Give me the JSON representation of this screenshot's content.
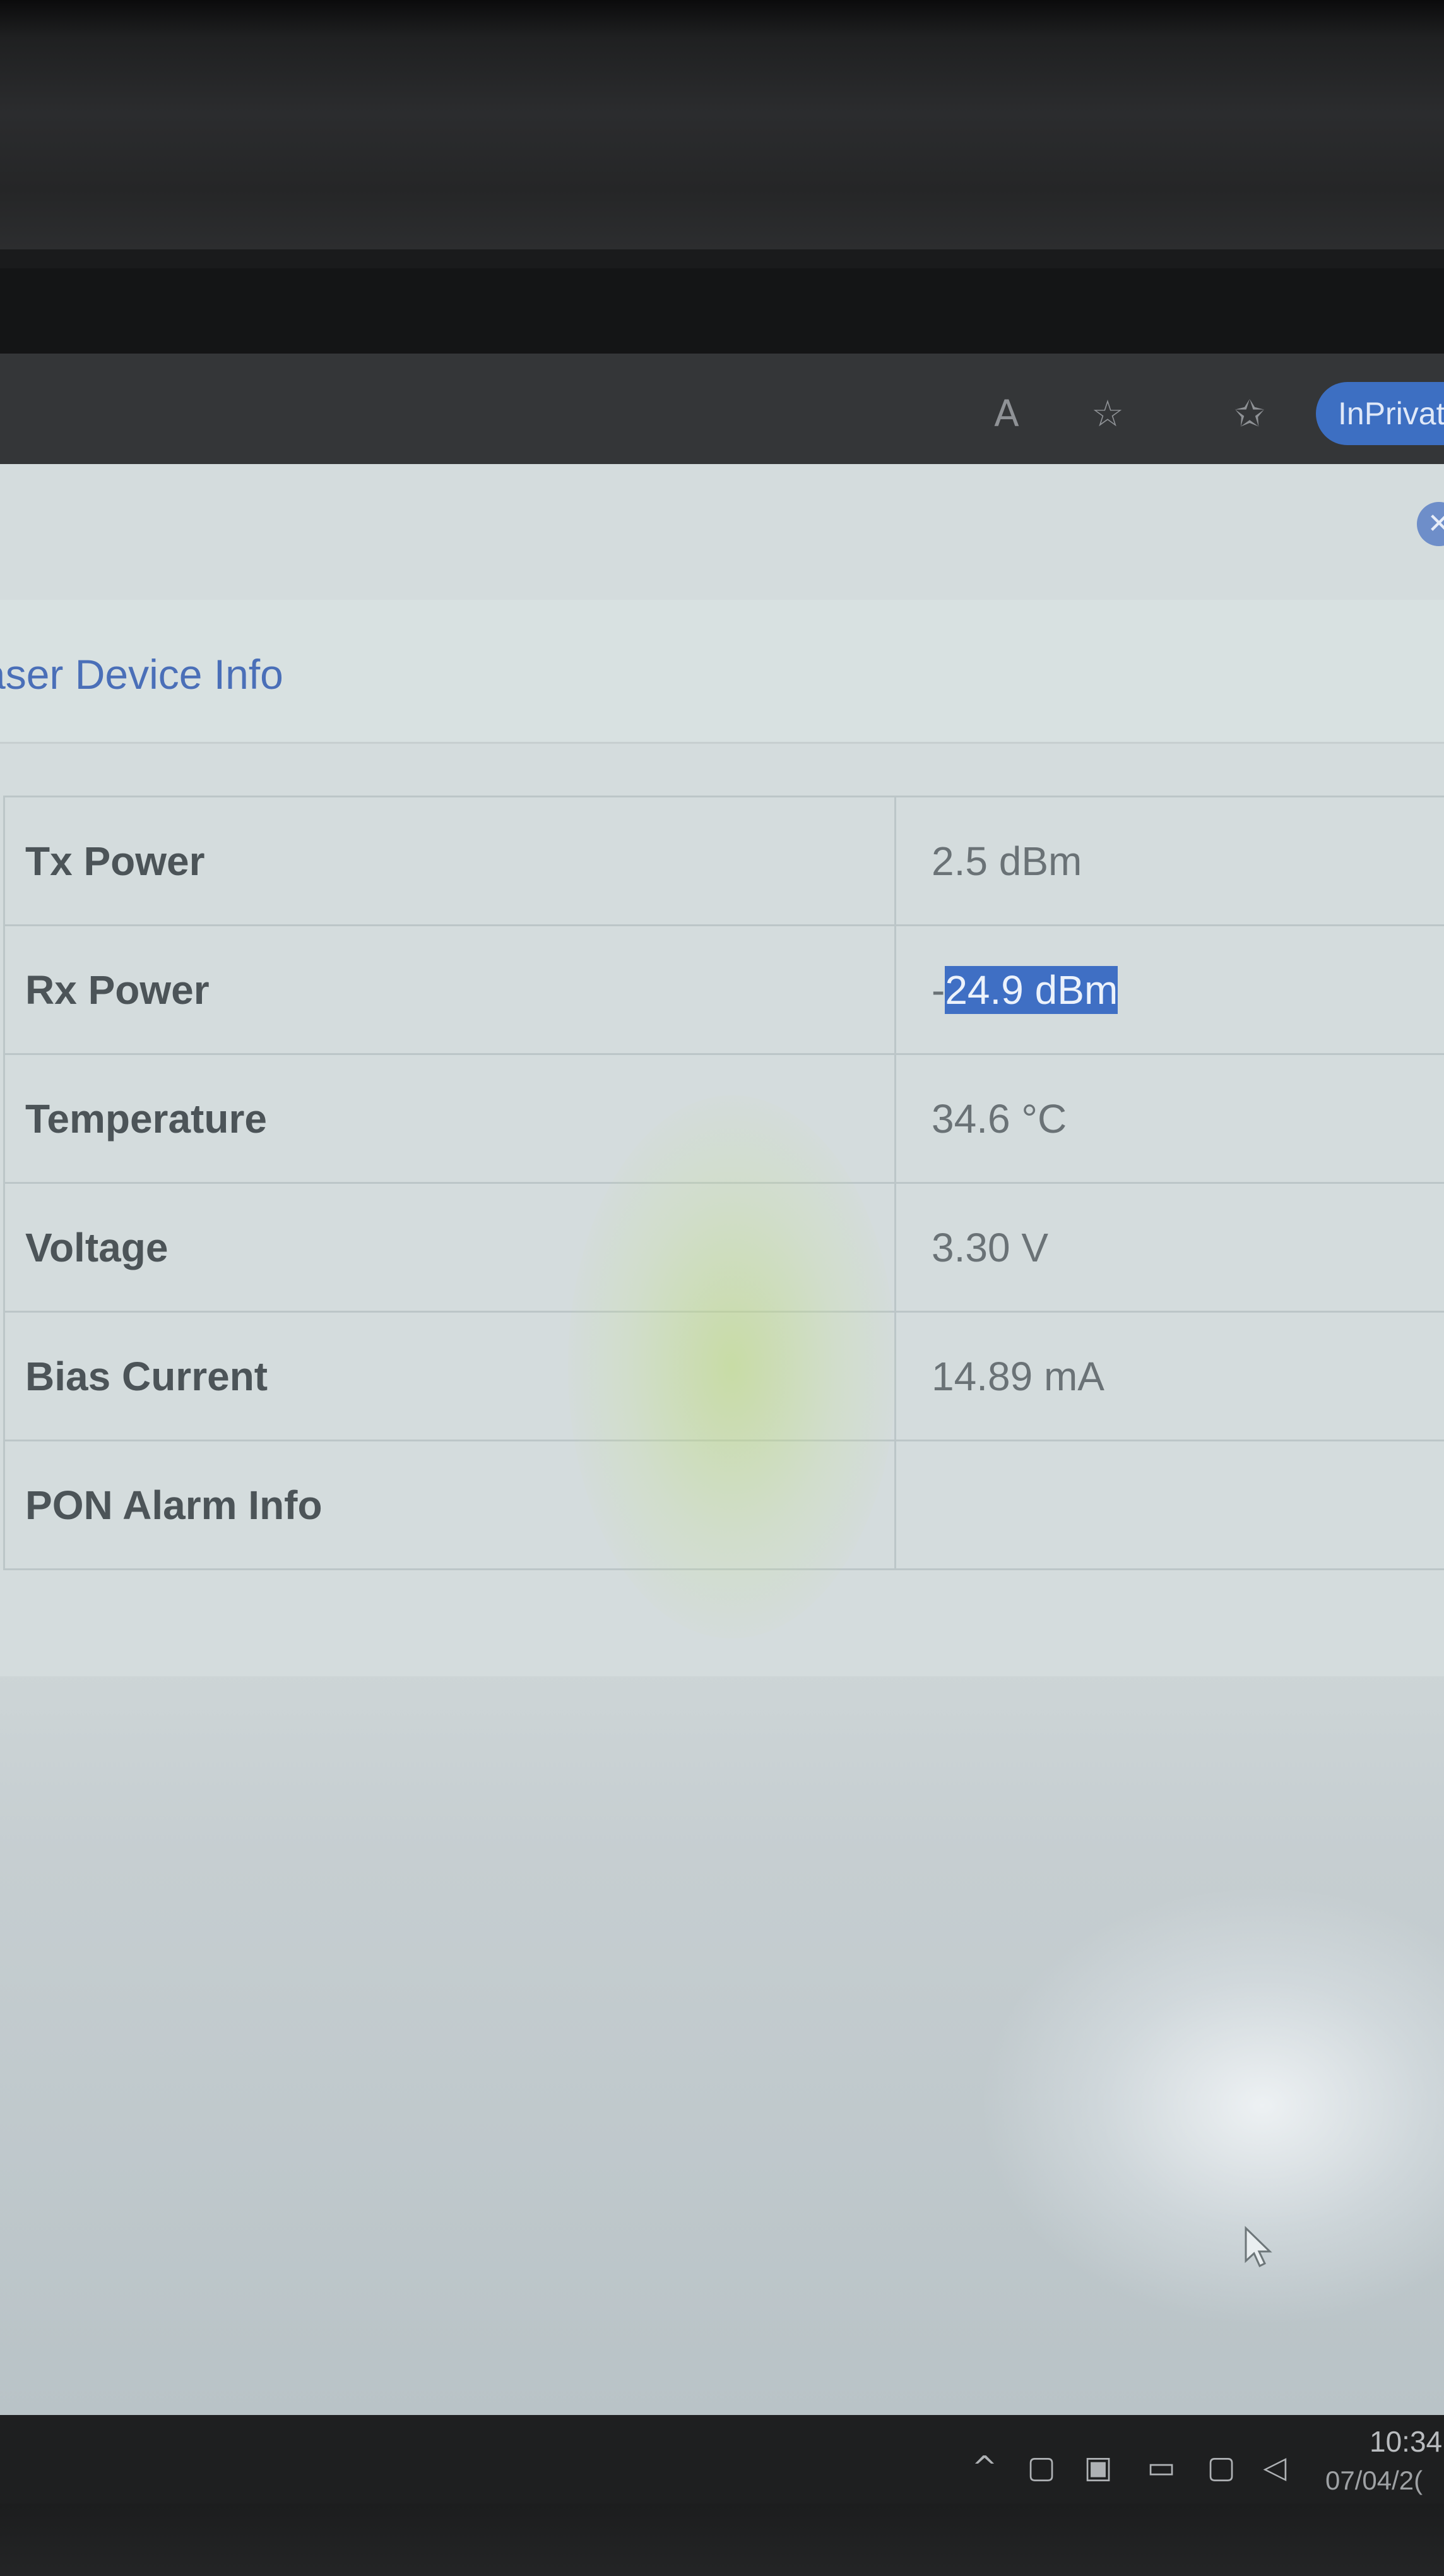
{
  "browser": {
    "toolbar_icons": [
      "read-aloud-icon",
      "favorite-star-icon",
      "favorites-list-icon"
    ],
    "inprivate_label": "InPrivat"
  },
  "modal": {
    "close_icon": "close-icon",
    "section_title": "aser Device Info",
    "rows": [
      {
        "label": "Tx Power",
        "value": "2.5 dBm"
      },
      {
        "label": "Rx Power",
        "value_prefix": "-",
        "value": "24.9 dBm",
        "value_selected": true
      },
      {
        "label": "Temperature",
        "value": "34.6 °C"
      },
      {
        "label": "Voltage",
        "value": "3.30 V"
      },
      {
        "label": "Bias Current",
        "value": "14.89 mA"
      },
      {
        "label": "PON Alarm Info",
        "value": ""
      }
    ]
  },
  "taskbar": {
    "tray_icons": [
      "chevron-up-icon",
      "meet-now-icon",
      "app-tray-icon",
      "battery-icon",
      "network-icon",
      "volume-icon"
    ],
    "time": "10:34",
    "date": "07/04/2("
  },
  "colors": {
    "accent": "#3f6fc4",
    "title": "#4a6fb8",
    "label_text": "#4c5458",
    "value_text": "#6a7276"
  }
}
